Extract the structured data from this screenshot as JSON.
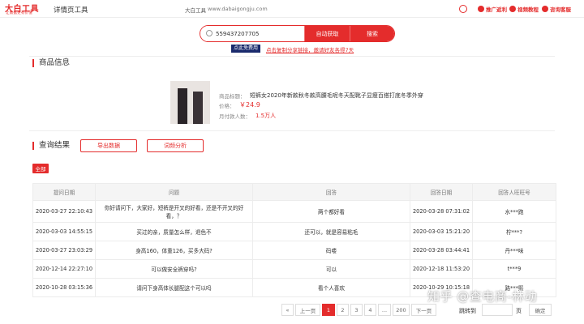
{
  "header": {
    "logo_text": "大白工具",
    "logo_sub": "让数据更有价值",
    "app_title": "详情页工具",
    "site_brand": "大白工具",
    "site_url": "www.dabaigongju.com",
    "links": [
      {
        "label": "推广返利",
        "icon": "gift-icon"
      },
      {
        "label": "视频教程",
        "icon": "play-icon"
      },
      {
        "label": "咨询客服",
        "icon": "headset-icon"
      }
    ]
  },
  "search": {
    "value": "559437207705",
    "auto_label": "自动获取",
    "search_label": "搜索"
  },
  "promo": {
    "free_badge": "点此免费用",
    "share_text": "点击复制分享链接，邀请好友各得7天"
  },
  "product": {
    "section_title": "商品信息",
    "title_label": "商品标题：",
    "title": "短裤女2020年新款秋冬款高腰毛呢冬天配靴子显瘦百搭打底冬季外穿",
    "price_label": "价格：",
    "price": "￥24.9",
    "sales_label": "月付款人数：",
    "sales": "1.5万人"
  },
  "results": {
    "section_title": "查询结果",
    "export_label": "导出数据",
    "analysis_label": "词频分析",
    "tag_all": "全部",
    "columns": [
      "提问日期",
      "问题",
      "回答",
      "回答日期",
      "回答人旺旺号"
    ],
    "rows": [
      [
        "2020-03-27 22:10:43",
        "你好请问下，大家好，短裤是开叉的好看，还是不开叉的好看，？",
        "两个都好看",
        "2020-03-28 07:31:02",
        "水***跑"
      ],
      [
        "2020-03-03 14:55:15",
        "买过的亲，质量怎么样，退色不",
        "还可以，就是容易粘毛",
        "2020-03-03 15:21:20",
        "柠***?"
      ],
      [
        "2020-03-27 23:03:29",
        "身高160，体重126，买多大码?",
        "码喽",
        "2020-03-28 03:44:41",
        "丹***味"
      ],
      [
        "2020-12-14 22:27:10",
        "可以做安全裤穿吗?",
        "可以",
        "2020-12-18 11:53:20",
        "t***9"
      ],
      [
        "2020-10-28 03:15:36",
        "请问下身高体长腿配这个可以吗",
        "看个人喜欢",
        "2020-10-29 10:15:18",
        "路***熙"
      ]
    ]
  },
  "pagination": {
    "first_symbol": "«",
    "prev_label": "上一页",
    "pages": [
      "1",
      "2",
      "3",
      "4"
    ],
    "ellipsis": "...",
    "last_page": "200",
    "next_label": "下一页",
    "jump_label": "跳转到",
    "page_unit": "页",
    "confirm_label": "确定"
  },
  "watermark": "知乎 @查电商-林动",
  "colors": {
    "accent": "#e42c2c",
    "badge": "#1a2a6c"
  }
}
